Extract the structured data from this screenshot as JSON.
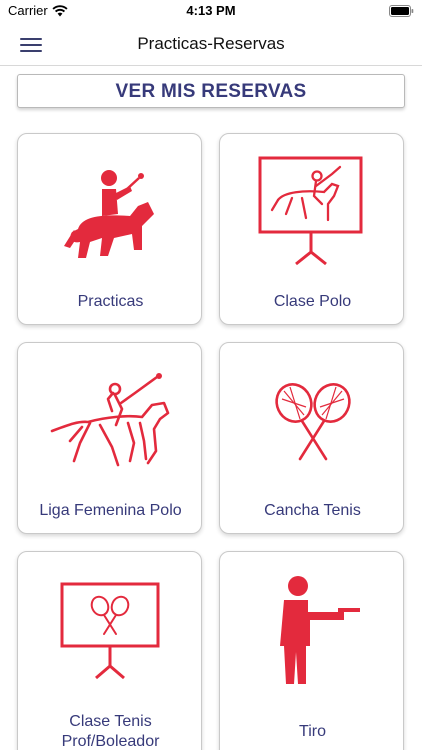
{
  "status": {
    "carrier": "Carrier",
    "time": "4:13 PM",
    "wifi_icon": "wifi-icon",
    "battery_icon": "battery-icon"
  },
  "nav": {
    "title": "Practicas-Reservas",
    "menu_icon": "hamburger-menu-icon"
  },
  "reservas_button": "VER MIS RESERVAS",
  "cards": [
    {
      "label": "Practicas",
      "icon": "polo-rider-icon"
    },
    {
      "label": "Clase Polo",
      "icon": "polo-class-board-icon"
    },
    {
      "label": "Liga Femenina Polo",
      "icon": "women-polo-icon"
    },
    {
      "label": "Cancha Tenis",
      "icon": "tennis-rackets-icon"
    },
    {
      "label": "Clase Tenis Prof/Boleador",
      "icon": "tennis-class-board-icon"
    },
    {
      "label": "Tiro",
      "icon": "shooter-icon"
    }
  ],
  "colors": {
    "accent_red": "#e32a3d",
    "label_navy": "#373a7a"
  }
}
